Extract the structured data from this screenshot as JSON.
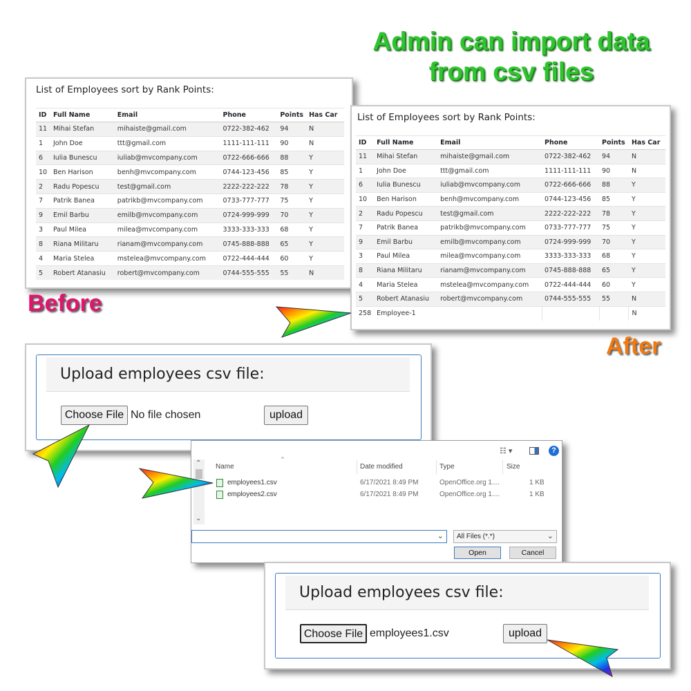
{
  "headline": {
    "line1": "Admin can import data",
    "line2": "from csv files"
  },
  "labels": {
    "before": "Before",
    "after": "After"
  },
  "table_before": {
    "title": "List of Employees sort by Rank Points:",
    "columns": [
      "ID",
      "Full Name",
      "Email",
      "Phone",
      "Points",
      "Has Car"
    ],
    "rows": [
      [
        "11",
        "Mihai Stefan",
        "mihaiste@gmail.com",
        "0722-382-462",
        "94",
        "N"
      ],
      [
        "1",
        "John Doe",
        "ttt@gmail.com",
        "1111-111-111",
        "90",
        "N"
      ],
      [
        "6",
        "Iulia Bunescu",
        "iuliab@mvcompany.com",
        "0722-666-666",
        "88",
        "Y"
      ],
      [
        "10",
        "Ben Harison",
        "benh@mvcompany.com",
        "0744-123-456",
        "85",
        "Y"
      ],
      [
        "2",
        "Radu Popescu",
        "test@gmail.com",
        "2222-222-222",
        "78",
        "Y"
      ],
      [
        "7",
        "Patrik Banea",
        "patrikb@mvcompany.com",
        "0733-777-777",
        "75",
        "Y"
      ],
      [
        "9",
        "Emil Barbu",
        "emilb@mvcompany.com",
        "0724-999-999",
        "70",
        "Y"
      ],
      [
        "3",
        "Paul Milea",
        "milea@mvcompany.com",
        "3333-333-333",
        "68",
        "Y"
      ],
      [
        "8",
        "Riana Militaru",
        "rianam@mvcompany.com",
        "0745-888-888",
        "65",
        "Y"
      ],
      [
        "4",
        "Maria Stelea",
        "mstelea@mvcompany.com",
        "0722-444-444",
        "60",
        "Y"
      ],
      [
        "5",
        "Robert Atanasiu",
        "robert@mvcompany.com",
        "0744-555-555",
        "55",
        "N"
      ]
    ]
  },
  "table_after": {
    "title": "List of Employees sort by Rank Points:",
    "columns": [
      "ID",
      "Full Name",
      "Email",
      "Phone",
      "Points",
      "Has Car"
    ],
    "rows": [
      [
        "11",
        "Mihai Stefan",
        "mihaiste@gmail.com",
        "0722-382-462",
        "94",
        "N"
      ],
      [
        "1",
        "John Doe",
        "ttt@gmail.com",
        "1111-111-111",
        "90",
        "N"
      ],
      [
        "6",
        "Iulia Bunescu",
        "iuliab@mvcompany.com",
        "0722-666-666",
        "88",
        "Y"
      ],
      [
        "10",
        "Ben Harison",
        "benh@mvcompany.com",
        "0744-123-456",
        "85",
        "Y"
      ],
      [
        "2",
        "Radu Popescu",
        "test@gmail.com",
        "2222-222-222",
        "78",
        "Y"
      ],
      [
        "7",
        "Patrik Banea",
        "patrikb@mvcompany.com",
        "0733-777-777",
        "75",
        "Y"
      ],
      [
        "9",
        "Emil Barbu",
        "emilb@mvcompany.com",
        "0724-999-999",
        "70",
        "Y"
      ],
      [
        "3",
        "Paul Milea",
        "milea@mvcompany.com",
        "3333-333-333",
        "68",
        "Y"
      ],
      [
        "8",
        "Riana Militaru",
        "rianam@mvcompany.com",
        "0745-888-888",
        "65",
        "Y"
      ],
      [
        "4",
        "Maria Stelea",
        "mstelea@mvcompany.com",
        "0722-444-444",
        "60",
        "Y"
      ],
      [
        "5",
        "Robert Atanasiu",
        "robert@mvcompany.com",
        "0744-555-555",
        "55",
        "N"
      ],
      [
        "258",
        "Employee-1",
        "",
        "",
        "",
        "N"
      ]
    ]
  },
  "upload_form_1": {
    "heading": "Upload employees csv file:",
    "choose_label": "Choose File",
    "file_status": "No file chosen",
    "upload_label": "upload"
  },
  "upload_form_2": {
    "heading": "Upload employees csv file:",
    "choose_label": "Choose File",
    "file_status": "employees1.csv",
    "upload_label": "upload"
  },
  "file_dialog": {
    "columns": {
      "name": "Name",
      "date": "Date modified",
      "type": "Type",
      "size": "Size"
    },
    "files": [
      {
        "name": "employees1.csv",
        "date": "6/17/2021 8:49 PM",
        "type": "OpenOffice.org 1....",
        "size": "1 KB"
      },
      {
        "name": "employees2.csv",
        "date": "6/17/2021 8:49 PM",
        "type": "OpenOffice.org 1....",
        "size": "1 KB"
      }
    ],
    "filter_label": "All Files (*.*)",
    "open_label": "Open",
    "cancel_label": "Cancel",
    "icons": [
      "view-menu-icon",
      "preview-pane-icon",
      "help-icon",
      "csv-file-icon",
      "scroll-up-icon",
      "scroll-down-icon",
      "sort-arrow-icon",
      "dropdown-chevron-icon"
    ]
  },
  "colors": {
    "headline": "#2ec52e",
    "before": "#e0156e",
    "after": "#f07a12",
    "card_border": "#3d7bc4"
  }
}
